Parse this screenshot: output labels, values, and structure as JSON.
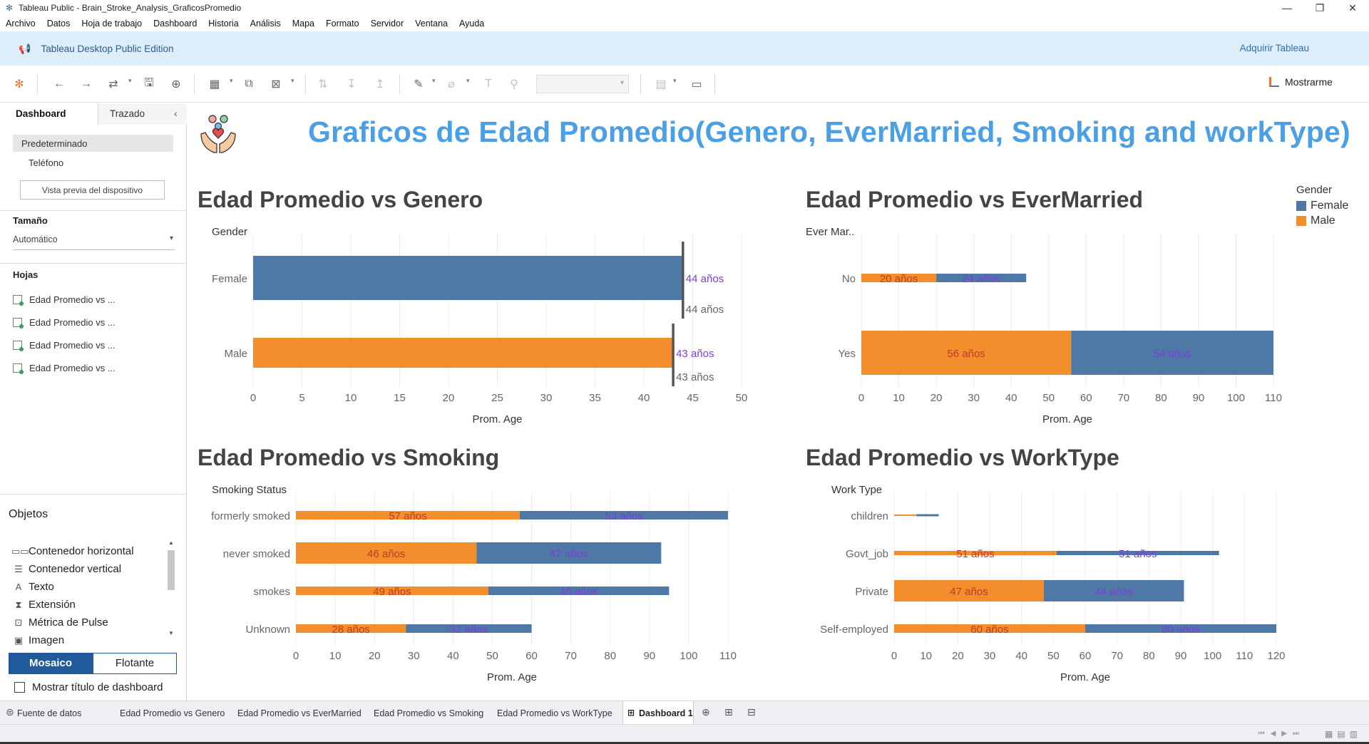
{
  "window": {
    "title": "Tableau Public - Brain_Stroke_Analysis_GraficosPromedio",
    "controls": [
      "minimize-icon",
      "restore-icon",
      "close-icon"
    ]
  },
  "menu": [
    "Archivo",
    "Datos",
    "Hoja de trabajo",
    "Dashboard",
    "Historia",
    "Análisis",
    "Mapa",
    "Formato",
    "Servidor",
    "Ventana",
    "Ayuda"
  ],
  "banner": {
    "edition": "Tableau Desktop Public Edition",
    "acquire": "Adquirir Tableau"
  },
  "toolbar": {
    "show_me": "Mostrarme"
  },
  "left_panel": {
    "tab_dashboard": "Dashboard",
    "tab_layout": "Trazado",
    "device_default": "Predeterminado",
    "device_phone": "Teléfono",
    "device_preview": "Vista previa del dispositivo",
    "size_header": "Tamaño",
    "size_value": "Automático",
    "sheets_header": "Hojas",
    "sheets": [
      "Edad Promedio  vs ...",
      "Edad Promedio  vs ...",
      "Edad Promedio  vs ...",
      "Edad Promedio  vs ..."
    ],
    "objects_header": "Objetos",
    "objects": [
      {
        "label": "Contenedor horizontal",
        "icon": "horizontal-container-icon"
      },
      {
        "label": "Contenedor vertical",
        "icon": "vertical-container-icon"
      },
      {
        "label": "Texto",
        "icon": "text-icon"
      },
      {
        "label": "Extensión",
        "icon": "extension-icon"
      },
      {
        "label": "Métrica de Pulse",
        "icon": "pulse-metric-icon"
      },
      {
        "label": "Imagen",
        "icon": "image-icon"
      }
    ],
    "tiled": "Mosaico",
    "floating": "Flotante",
    "show_title": "Mostrar título de dashboard"
  },
  "dashboard": {
    "title": "Graficos de Edad Promedio(Genero, EverMarried, Smoking and workType)"
  },
  "colors": {
    "female": "#4e79a7",
    "male": "#f28e2b",
    "label_purple": "#7b3fd6",
    "label_gray": "#666666",
    "title_blue": "#4b9fe4"
  },
  "legend": {
    "title": "Gender",
    "items": [
      {
        "name": "Female",
        "color": "#4e79a7"
      },
      {
        "name": "Male",
        "color": "#f28e2b"
      }
    ]
  },
  "chart_data": [
    {
      "type": "bar",
      "title": "Edad Promedio  vs Genero",
      "dim_header": "Gender",
      "xlabel": "Prom. Age",
      "xlim": [
        0,
        50
      ],
      "xticks": [
        0,
        5,
        10,
        15,
        20,
        25,
        30,
        35,
        40,
        45,
        50
      ],
      "categories": [
        "Female",
        "Male"
      ],
      "values": [
        44,
        43
      ],
      "value_labels": [
        "44 años",
        "43 años"
      ],
      "reference_labels": [
        "44 años",
        "43 años"
      ]
    },
    {
      "type": "bar",
      "stacked": true,
      "title": "Edad Promedio  vs EverMarried",
      "dim_header": "Ever Mar..",
      "xlabel": "Prom. Age",
      "xlim": [
        0,
        110
      ],
      "xticks": [
        0,
        10,
        20,
        30,
        40,
        50,
        60,
        70,
        80,
        90,
        100,
        110
      ],
      "categories": [
        "No",
        "Yes"
      ],
      "series": [
        {
          "name": "Male",
          "values": [
            20,
            56
          ],
          "labels": [
            "20 años",
            "56 años"
          ]
        },
        {
          "name": "Female",
          "values": [
            24,
            54
          ],
          "labels": [
            "24 años",
            "54 años"
          ]
        }
      ]
    },
    {
      "type": "bar",
      "stacked": true,
      "title": "Edad Promedio  vs Smoking",
      "dim_header": "Smoking Status",
      "xlabel": "Prom. Age",
      "xlim": [
        0,
        110
      ],
      "xticks": [
        0,
        10,
        20,
        30,
        40,
        50,
        60,
        70,
        80,
        90,
        100,
        110
      ],
      "categories": [
        "formerly smoked",
        "never smoked",
        "smokes",
        "Unknown"
      ],
      "series": [
        {
          "name": "Male",
          "values": [
            57,
            46,
            49,
            28
          ],
          "labels": [
            "57 años",
            "46 años",
            "49 años",
            "28 años"
          ]
        },
        {
          "name": "Female",
          "values": [
            53,
            47,
            46,
            32
          ],
          "labels": [
            "53 años",
            "47 años",
            "46 años",
            "32 años"
          ]
        }
      ]
    },
    {
      "type": "bar",
      "stacked": true,
      "title": "Edad Promedio  vs WorkType",
      "dim_header": "Work Type",
      "xlabel": "Prom. Age",
      "xlim": [
        0,
        120
      ],
      "xticks": [
        0,
        10,
        20,
        30,
        40,
        50,
        60,
        70,
        80,
        90,
        100,
        110,
        120
      ],
      "categories": [
        "children",
        "Govt_job",
        "Private",
        "Self-employed"
      ],
      "series": [
        {
          "name": "Male",
          "values": [
            7,
            51,
            47,
            60
          ],
          "labels": [
            "",
            "51 años",
            "47 años",
            "60 años"
          ]
        },
        {
          "name": "Female",
          "values": [
            7,
            51,
            44,
            60
          ],
          "labels": [
            "",
            "51 años",
            "44 años",
            "60 años"
          ]
        }
      ]
    }
  ],
  "bottom_tabs": [
    "Fuente de datos",
    "Edad Promedio  vs Genero",
    "Edad Promedio  vs EverMarried",
    "Edad Promedio  vs Smoking",
    "Edad Promedio  vs WorkType",
    "Dashboard 1"
  ]
}
